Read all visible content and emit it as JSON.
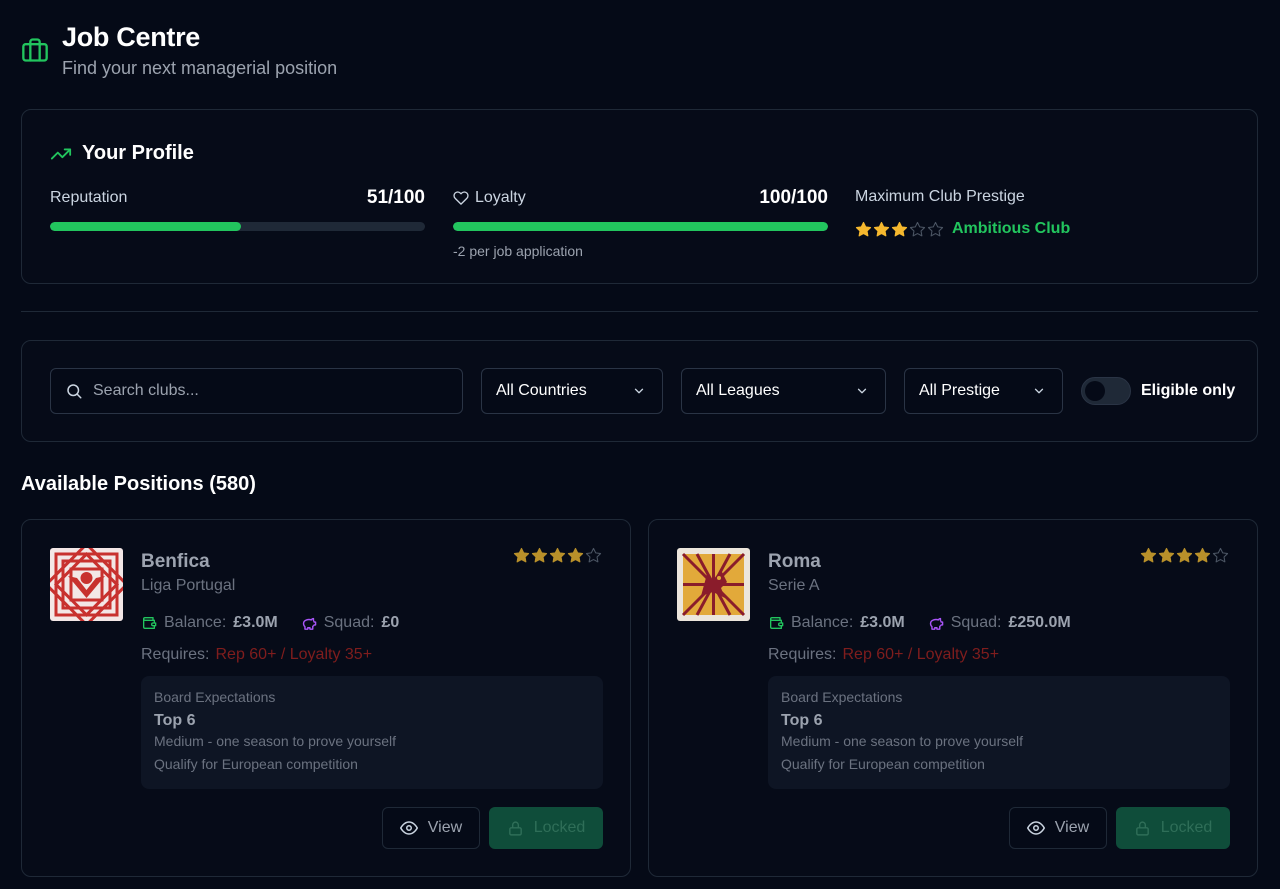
{
  "header": {
    "title": "Job Centre",
    "subtitle": "Find your next managerial position"
  },
  "profile": {
    "title": "Your Profile",
    "reputation": {
      "label": "Reputation",
      "value": "51/100",
      "fraction": 0.51
    },
    "loyalty": {
      "label": "Loyalty",
      "value": "100/100",
      "fraction": 1.0,
      "note": "-2 per job application"
    },
    "prestige": {
      "label": "Maximum Club Prestige",
      "stars": 3,
      "max_stars": 5,
      "tier": "Ambitious Club"
    }
  },
  "filters": {
    "search_placeholder": "Search clubs...",
    "country": "All Countries",
    "league": "All Leagues",
    "prestige": "All Prestige",
    "eligible_label": "Eligible only",
    "eligible_on": false
  },
  "positions": {
    "title": "Available Positions (580)",
    "clubs": [
      {
        "name": "Benfica",
        "league": "Liga Portugal",
        "stars": 4,
        "balance_label": "Balance:",
        "balance": "£3.0M",
        "squad_label": "Squad:",
        "squad": "£0",
        "requires_label": "Requires:",
        "requires": "Rep 60+ / Loyalty 35+",
        "board_label": "Board Expectations",
        "board_target": "Top 6",
        "board_desc": "Medium - one season to prove yourself",
        "board_goal": "Qualify for European competition",
        "view_label": "View",
        "locked_label": "Locked"
      },
      {
        "name": "Roma",
        "league": "Serie A",
        "stars": 4,
        "balance_label": "Balance:",
        "balance": "£3.0M",
        "squad_label": "Squad:",
        "squad": "£250.0M",
        "requires_label": "Requires:",
        "requires": "Rep 60+ / Loyalty 35+",
        "board_label": "Board Expectations",
        "board_target": "Top 6",
        "board_desc": "Medium - one season to prove yourself",
        "board_goal": "Qualify for European competition",
        "view_label": "View",
        "locked_label": "Locked"
      }
    ]
  },
  "colors": {
    "accent": "#22c55e",
    "star": "#f5b82e",
    "star_dim": "#b8902a",
    "locked_bg": "#0f4d3a",
    "requirement": "#7f1d1d"
  },
  "icons": [
    "briefcase-icon",
    "trending-up-icon",
    "heart-icon",
    "star-icon",
    "search-icon",
    "chevron-down-icon",
    "wallet-icon",
    "piggy-bank-icon",
    "eye-icon",
    "lock-icon"
  ]
}
